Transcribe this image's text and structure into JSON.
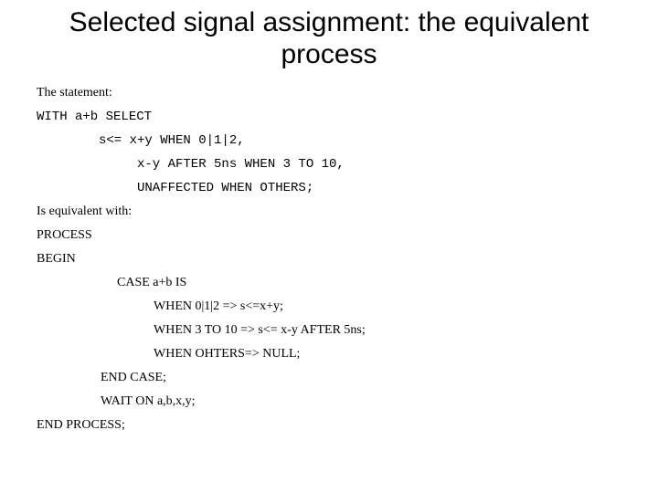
{
  "title": "Selected signal assignment: the equivalent process",
  "stmt_label": "The statement:",
  "code": {
    "l1": "WITH a+b SELECT",
    "l2": "s<= x+y WHEN 0|1|2,",
    "l3": "x-y AFTER 5ns WHEN 3 TO 10,",
    "l4": "UNAFFECTED WHEN OTHERS;"
  },
  "equiv_label": "Is equivalent with:",
  "proc": {
    "p1": "PROCESS",
    "p2": "BEGIN",
    "p3": "CASE a+b IS",
    "p4": "WHEN 0|1|2 => s<=x+y;",
    "p5": "WHEN 3 TO 10 => s<= x-y AFTER 5ns;",
    "p6": "WHEN OHTERS=> NULL;",
    "p7": "END CASE;",
    "p8": "WAIT ON a,b,x,y;",
    "p9": "END PROCESS;"
  }
}
